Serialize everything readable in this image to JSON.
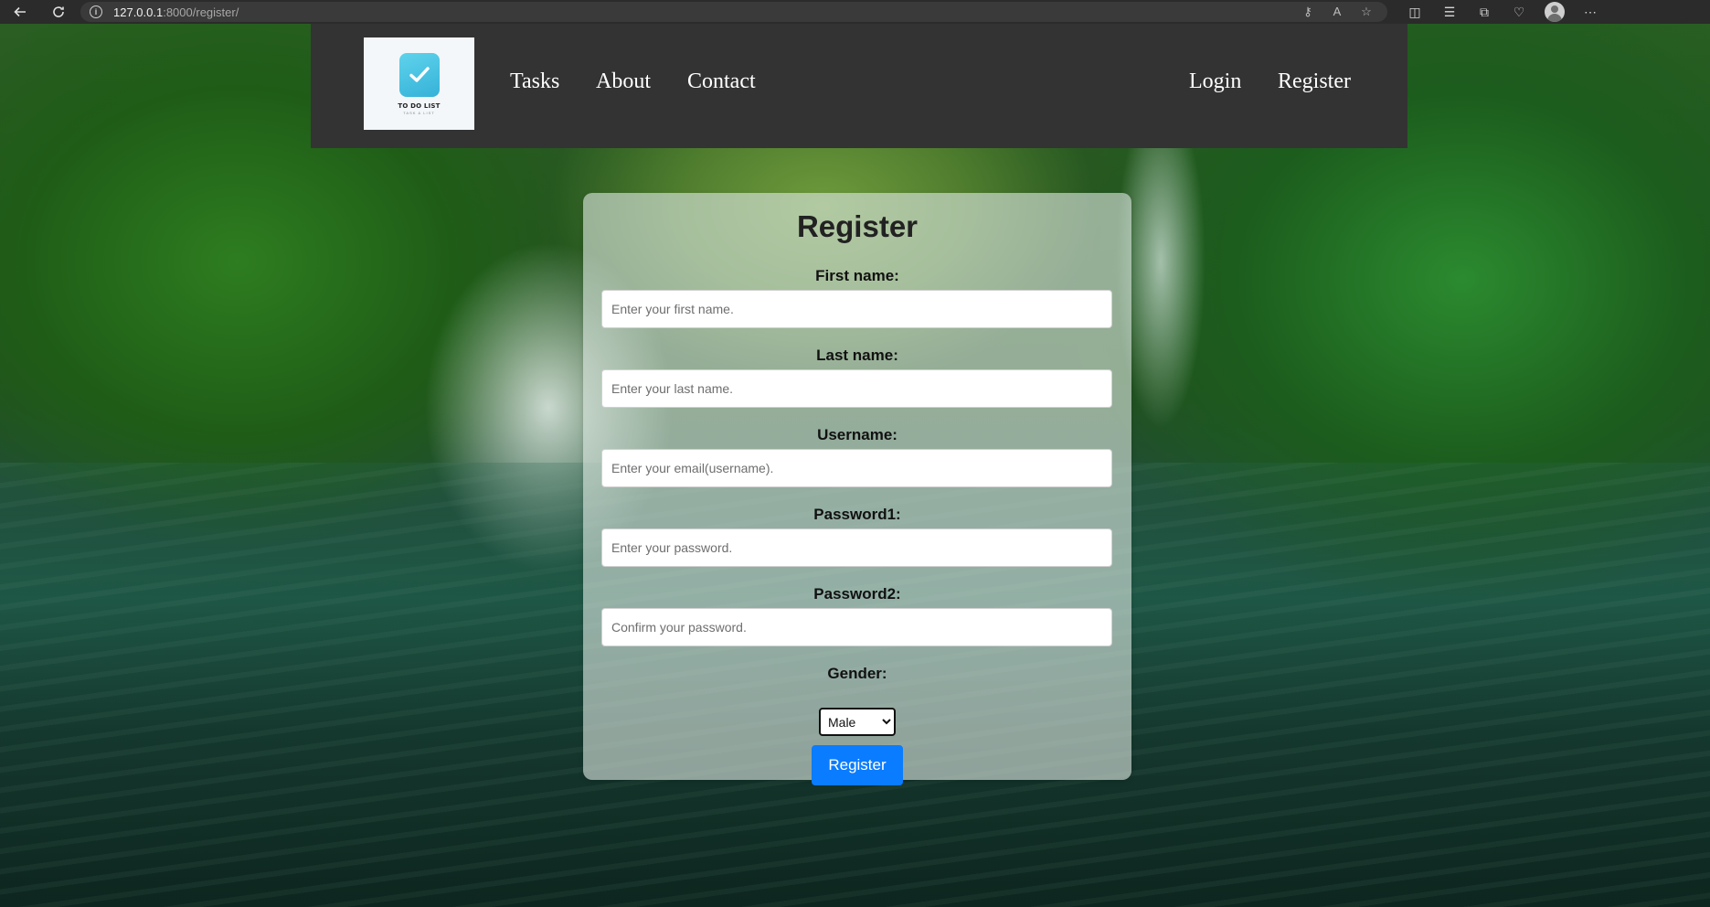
{
  "browser": {
    "url_host": "127.0.0.1",
    "url_rest": ":8000/register/"
  },
  "header": {
    "logo": {
      "title": "TO DO LIST",
      "subtitle": "TASK & LIST"
    },
    "nav_left": [
      "Tasks",
      "About",
      "Contact"
    ],
    "nav_right": [
      "Login",
      "Register"
    ]
  },
  "form": {
    "title": "Register",
    "fields": [
      {
        "label": "First name:",
        "placeholder": "Enter your first name."
      },
      {
        "label": "Last name:",
        "placeholder": "Enter your last name."
      },
      {
        "label": "Username:",
        "placeholder": "Enter your email(username)."
      },
      {
        "label": "Password1:",
        "placeholder": "Enter your password."
      },
      {
        "label": "Password2:",
        "placeholder": "Confirm your password."
      }
    ],
    "gender_label": "Gender:",
    "gender_value": "Male",
    "submit_label": "Register"
  },
  "colors": {
    "header_bg": "#333333",
    "button_bg": "#0a7cff",
    "logo_accent": "#35b2d8"
  }
}
